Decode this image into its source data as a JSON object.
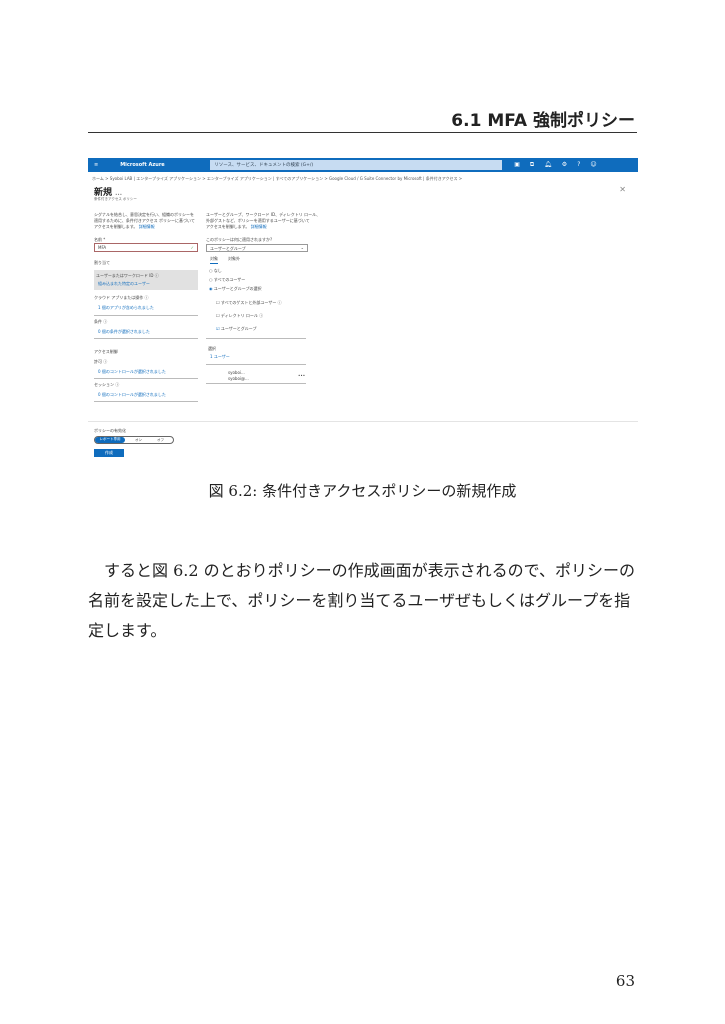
{
  "header": {
    "section_title": "6.1 MFA 強制ポリシー"
  },
  "screenshot": {
    "brand": "Microsoft Azure",
    "search_placeholder": "リソース、サービス、ドキュメントの検索 (G+/)",
    "breadcrumb": "ホーム > Syoboi LAB | エンタープライズ アプリケーション > エンタープライズ アプリケーション | すべてのアプリケーション > Google Cloud / G Suite Connector by Microsoft | 条件付きアクセス >",
    "title": "新規",
    "title_more": "...",
    "subtitle": "条件付きアクセス ポリシー",
    "close": "✕",
    "left": {
      "intro": [
        "シグナルを結合し、意思決定を行い、組織のポリシーを",
        "適用するために、条件付きアクセス ポリシーに基づいて",
        "アクセスを制御します。"
      ],
      "learn_more": "詳細情報",
      "name_label": "名前 *",
      "name_value": "MFA",
      "assignments": "割り当て",
      "users_label": "ユーザーまたはワークロード ID ⓘ",
      "users_value": "組み込まれた特定のユーザー",
      "apps_label": "クラウド アプリまたは操作 ⓘ",
      "apps_value": "1 個のアプリが含められました",
      "conditions_label": "条件 ⓘ",
      "conditions_value": "0 個の条件が選択されました",
      "access_controls": "アクセス制御",
      "grant_label": "許可 ⓘ",
      "grant_value": "0 個のコントロールが選択されました",
      "session_label": "セッション ⓘ",
      "session_value": "0 個のコントロールが選択されました"
    },
    "right": {
      "intro": [
        "ユーザーとグループ、ワークロード ID、ディレクトリ ロール、",
        "外部ゲストなど、ポリシーを適用するユーザーに基づいて",
        "アクセスを制御します。"
      ],
      "learn_more": "詳細情報",
      "applies_label": "このポリシーは何に適用されますか?",
      "applies_value": "ユーザーとグループ",
      "tab_include": "対象",
      "tab_exclude": "対象外",
      "radio_none": "なし",
      "radio_all": "すべてのユーザー",
      "radio_select": "ユーザーとグループの選択",
      "cb_guests": "すべてのゲストと外部ユーザー ⓘ",
      "cb_roles": "ディレクトリ ロール ⓘ",
      "cb_users": "ユーザーとグループ",
      "select_label": "選択",
      "select_value": "1 ユーザー",
      "user_name": "syoboi...",
      "user_email": "syoboi@...",
      "user_more": "•••"
    },
    "enable_label": "ポリシーの有効化",
    "toggle": [
      "レポート専用",
      "オン",
      "オフ"
    ],
    "create": "作成"
  },
  "caption": "図 6.2: 条件付きアクセスポリシーの新規作成",
  "paragraph": "すると図 6.2 のとおりポリシーの作成画面が表示されるので、ポリシーの名前を設定した上で、ポリシーを割り当てるユーザぜもしくはグループを指定します。",
  "page_number": "63"
}
